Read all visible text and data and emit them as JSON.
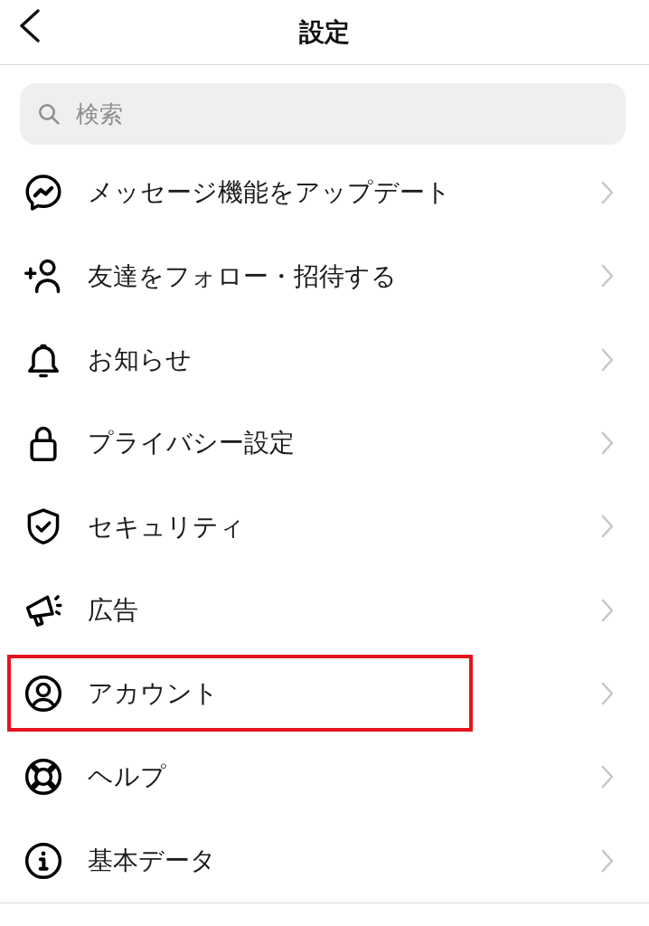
{
  "header": {
    "title": "設定"
  },
  "search": {
    "placeholder": "検索"
  },
  "items": [
    {
      "label": "メッセージ機能をアップデート",
      "highlighted": false
    },
    {
      "label": "友達をフォロー・招待する",
      "highlighted": false
    },
    {
      "label": "お知らせ",
      "highlighted": false
    },
    {
      "label": "プライバシー設定",
      "highlighted": false
    },
    {
      "label": "セキュリティ",
      "highlighted": false
    },
    {
      "label": "広告",
      "highlighted": false
    },
    {
      "label": "アカウント",
      "highlighted": true
    },
    {
      "label": "ヘルプ",
      "highlighted": false
    },
    {
      "label": "基本データ",
      "highlighted": false
    }
  ]
}
